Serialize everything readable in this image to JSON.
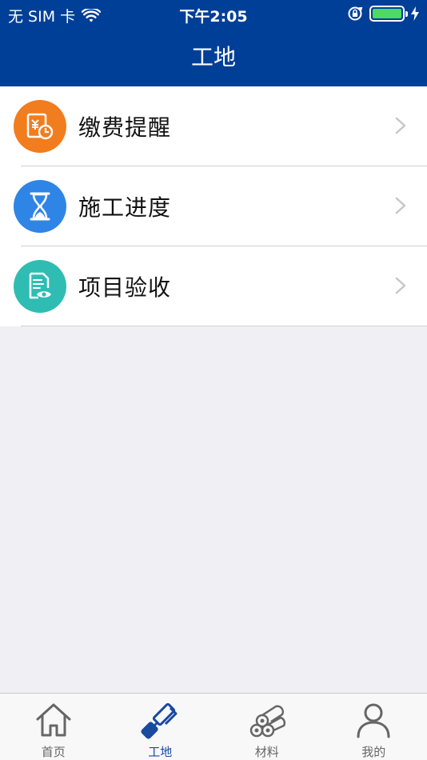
{
  "status_bar": {
    "carrier": "无 SIM 卡",
    "time": "下午2:05"
  },
  "nav": {
    "title": "工地"
  },
  "list": {
    "items": [
      {
        "label": "缴费提醒",
        "icon": "bill-clock-icon",
        "color": "#f17d1e"
      },
      {
        "label": "施工进度",
        "icon": "hourglass-icon",
        "color": "#2f85e6"
      },
      {
        "label": "项目验收",
        "icon": "document-eye-icon",
        "color": "#2fbdb3"
      }
    ]
  },
  "tabs": {
    "items": [
      {
        "label": "首页",
        "icon": "home-icon"
      },
      {
        "label": "工地",
        "icon": "paint-roller-icon",
        "active": true
      },
      {
        "label": "材料",
        "icon": "pipes-icon"
      },
      {
        "label": "我的",
        "icon": "person-icon"
      }
    ]
  },
  "colors": {
    "brand": "#003f98",
    "active_tab": "#1a4aa0",
    "battery": "#4cd964",
    "background": "#efeff4"
  }
}
